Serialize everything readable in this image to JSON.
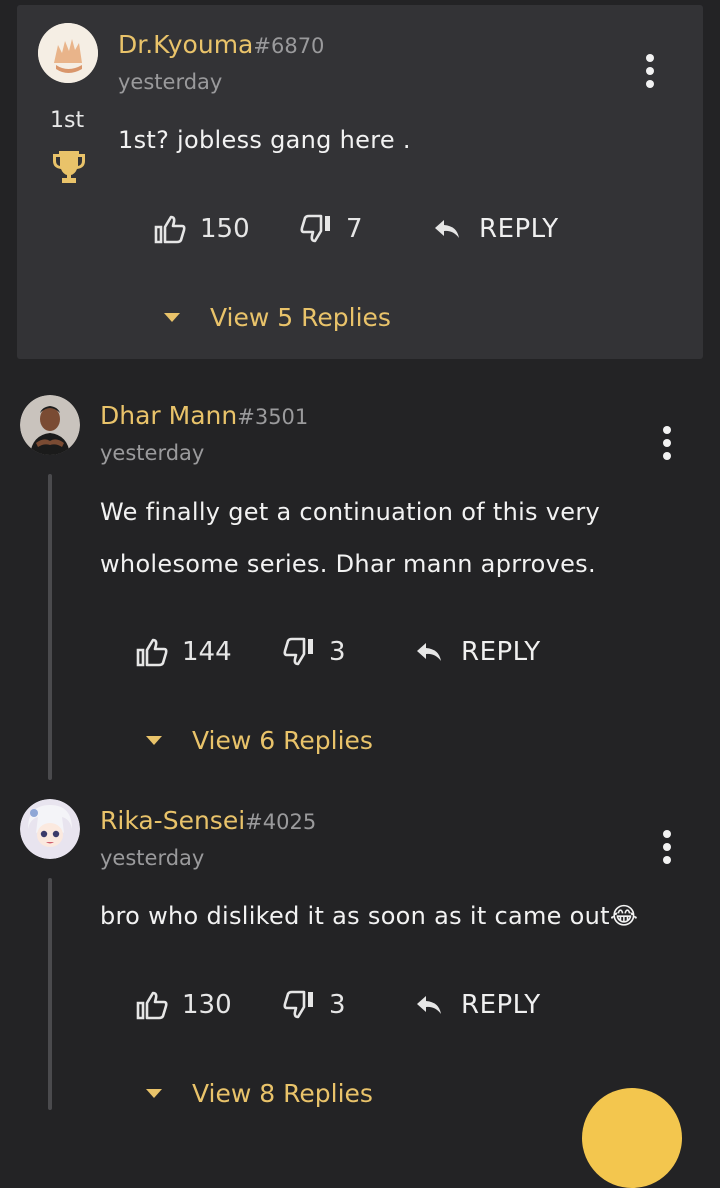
{
  "comments": [
    {
      "username": "Dr.Kyouma",
      "tag": "#6870",
      "time": "yesterday",
      "rank": "1st",
      "text_lines": [
        "1st? jobless gang here ."
      ],
      "likes": "150",
      "dislikes": "7",
      "reply_label": "REPLY",
      "view_replies": "View 5 Replies"
    },
    {
      "username": "Dhar Mann",
      "tag": "#3501",
      "time": "yesterday",
      "text_lines": [
        "We finally get a continuation of this very",
        "wholesome series. Dhar mann aprroves."
      ],
      "likes": "144",
      "dislikes": "3",
      "reply_label": "REPLY",
      "view_replies": "View 6 Replies"
    },
    {
      "username": "Rika-Sensei",
      "tag": "#4025",
      "time": "yesterday",
      "text_lines": [
        "bro who disliked it as soon as it came out😂"
      ],
      "likes": "130",
      "dislikes": "3",
      "reply_label": "REPLY",
      "view_replies": "View 8 Replies"
    }
  ],
  "colors": {
    "background": "#232325",
    "pinned_card": "#333336",
    "accent": "#e9c36a",
    "muted": "#9a9a9c"
  },
  "icons": [
    "trophy-icon",
    "thumbs-up-icon",
    "thumbs-down-icon",
    "reply-arrow-icon",
    "more-vert-icon",
    "caret-down-icon"
  ]
}
